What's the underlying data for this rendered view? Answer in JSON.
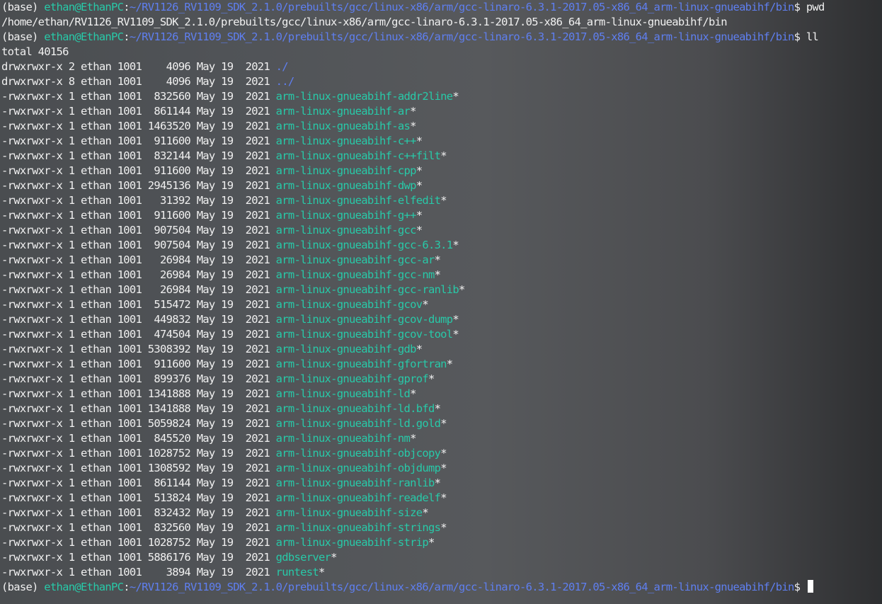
{
  "colors": {
    "user": "#28c9a8",
    "path": "#5f7ff0",
    "text": "#f0f0f0",
    "executable": "#28c9a8",
    "directory": "#5f7ff0"
  },
  "prompt": {
    "env": "(base) ",
    "user": "ethan@EthanPC",
    "sep": ":",
    "cwd": "~/RV1126_RV1109_SDK_2.1.0/prebuilts/gcc/linux-x86/arm/gcc-linaro-6.3.1-2017.05-x86_64_arm-linux-gnueabihf/bin",
    "symbol": "$"
  },
  "commands": [
    " pwd",
    " ll",
    " "
  ],
  "pwd_output": "/home/ethan/RV1126_RV1109_SDK_2.1.0/prebuilts/gcc/linux-x86/arm/gcc-linaro-6.3.1-2017.05-x86_64_arm-linux-gnueabihf/bin",
  "total": "total 40156",
  "listing": [
    {
      "perm": "drwxrwxr-x",
      "links": "2",
      "owner": "ethan",
      "group": "1001",
      "size": "4096",
      "date": "May 19  2021",
      "name": "./",
      "kind": "dir",
      "suffix": ""
    },
    {
      "perm": "drwxrwxr-x",
      "links": "8",
      "owner": "ethan",
      "group": "1001",
      "size": "4096",
      "date": "May 19  2021",
      "name": "../",
      "kind": "dir",
      "suffix": ""
    },
    {
      "perm": "-rwxrwxr-x",
      "links": "1",
      "owner": "ethan",
      "group": "1001",
      "size": "832560",
      "date": "May 19  2021",
      "name": "arm-linux-gnueabihf-addr2line",
      "kind": "exe",
      "suffix": "*"
    },
    {
      "perm": "-rwxrwxr-x",
      "links": "1",
      "owner": "ethan",
      "group": "1001",
      "size": "861144",
      "date": "May 19  2021",
      "name": "arm-linux-gnueabihf-ar",
      "kind": "exe",
      "suffix": "*"
    },
    {
      "perm": "-rwxrwxr-x",
      "links": "1",
      "owner": "ethan",
      "group": "1001",
      "size": "1463520",
      "date": "May 19  2021",
      "name": "arm-linux-gnueabihf-as",
      "kind": "exe",
      "suffix": "*"
    },
    {
      "perm": "-rwxrwxr-x",
      "links": "1",
      "owner": "ethan",
      "group": "1001",
      "size": "911600",
      "date": "May 19  2021",
      "name": "arm-linux-gnueabihf-c++",
      "kind": "exe",
      "suffix": "*"
    },
    {
      "perm": "-rwxrwxr-x",
      "links": "1",
      "owner": "ethan",
      "group": "1001",
      "size": "832144",
      "date": "May 19  2021",
      "name": "arm-linux-gnueabihf-c++filt",
      "kind": "exe",
      "suffix": "*"
    },
    {
      "perm": "-rwxrwxr-x",
      "links": "1",
      "owner": "ethan",
      "group": "1001",
      "size": "911600",
      "date": "May 19  2021",
      "name": "arm-linux-gnueabihf-cpp",
      "kind": "exe",
      "suffix": "*"
    },
    {
      "perm": "-rwxrwxr-x",
      "links": "1",
      "owner": "ethan",
      "group": "1001",
      "size": "2945136",
      "date": "May 19  2021",
      "name": "arm-linux-gnueabihf-dwp",
      "kind": "exe",
      "suffix": "*"
    },
    {
      "perm": "-rwxrwxr-x",
      "links": "1",
      "owner": "ethan",
      "group": "1001",
      "size": "31392",
      "date": "May 19  2021",
      "name": "arm-linux-gnueabihf-elfedit",
      "kind": "exe",
      "suffix": "*"
    },
    {
      "perm": "-rwxrwxr-x",
      "links": "1",
      "owner": "ethan",
      "group": "1001",
      "size": "911600",
      "date": "May 19  2021",
      "name": "arm-linux-gnueabihf-g++",
      "kind": "exe",
      "suffix": "*"
    },
    {
      "perm": "-rwxrwxr-x",
      "links": "1",
      "owner": "ethan",
      "group": "1001",
      "size": "907504",
      "date": "May 19  2021",
      "name": "arm-linux-gnueabihf-gcc",
      "kind": "exe",
      "suffix": "*"
    },
    {
      "perm": "-rwxrwxr-x",
      "links": "1",
      "owner": "ethan",
      "group": "1001",
      "size": "907504",
      "date": "May 19  2021",
      "name": "arm-linux-gnueabihf-gcc-6.3.1",
      "kind": "exe",
      "suffix": "*"
    },
    {
      "perm": "-rwxrwxr-x",
      "links": "1",
      "owner": "ethan",
      "group": "1001",
      "size": "26984",
      "date": "May 19  2021",
      "name": "arm-linux-gnueabihf-gcc-ar",
      "kind": "exe",
      "suffix": "*"
    },
    {
      "perm": "-rwxrwxr-x",
      "links": "1",
      "owner": "ethan",
      "group": "1001",
      "size": "26984",
      "date": "May 19  2021",
      "name": "arm-linux-gnueabihf-gcc-nm",
      "kind": "exe",
      "suffix": "*"
    },
    {
      "perm": "-rwxrwxr-x",
      "links": "1",
      "owner": "ethan",
      "group": "1001",
      "size": "26984",
      "date": "May 19  2021",
      "name": "arm-linux-gnueabihf-gcc-ranlib",
      "kind": "exe",
      "suffix": "*"
    },
    {
      "perm": "-rwxrwxr-x",
      "links": "1",
      "owner": "ethan",
      "group": "1001",
      "size": "515472",
      "date": "May 19  2021",
      "name": "arm-linux-gnueabihf-gcov",
      "kind": "exe",
      "suffix": "*"
    },
    {
      "perm": "-rwxrwxr-x",
      "links": "1",
      "owner": "ethan",
      "group": "1001",
      "size": "449832",
      "date": "May 19  2021",
      "name": "arm-linux-gnueabihf-gcov-dump",
      "kind": "exe",
      "suffix": "*"
    },
    {
      "perm": "-rwxrwxr-x",
      "links": "1",
      "owner": "ethan",
      "group": "1001",
      "size": "474504",
      "date": "May 19  2021",
      "name": "arm-linux-gnueabihf-gcov-tool",
      "kind": "exe",
      "suffix": "*"
    },
    {
      "perm": "-rwxrwxr-x",
      "links": "1",
      "owner": "ethan",
      "group": "1001",
      "size": "5308392",
      "date": "May 19  2021",
      "name": "arm-linux-gnueabihf-gdb",
      "kind": "exe",
      "suffix": "*"
    },
    {
      "perm": "-rwxrwxr-x",
      "links": "1",
      "owner": "ethan",
      "group": "1001",
      "size": "911600",
      "date": "May 19  2021",
      "name": "arm-linux-gnueabihf-gfortran",
      "kind": "exe",
      "suffix": "*"
    },
    {
      "perm": "-rwxrwxr-x",
      "links": "1",
      "owner": "ethan",
      "group": "1001",
      "size": "899376",
      "date": "May 19  2021",
      "name": "arm-linux-gnueabihf-gprof",
      "kind": "exe",
      "suffix": "*"
    },
    {
      "perm": "-rwxrwxr-x",
      "links": "1",
      "owner": "ethan",
      "group": "1001",
      "size": "1341888",
      "date": "May 19  2021",
      "name": "arm-linux-gnueabihf-ld",
      "kind": "exe",
      "suffix": "*"
    },
    {
      "perm": "-rwxrwxr-x",
      "links": "1",
      "owner": "ethan",
      "group": "1001",
      "size": "1341888",
      "date": "May 19  2021",
      "name": "arm-linux-gnueabihf-ld.bfd",
      "kind": "exe",
      "suffix": "*"
    },
    {
      "perm": "-rwxrwxr-x",
      "links": "1",
      "owner": "ethan",
      "group": "1001",
      "size": "5059824",
      "date": "May 19  2021",
      "name": "arm-linux-gnueabihf-ld.gold",
      "kind": "exe",
      "suffix": "*"
    },
    {
      "perm": "-rwxrwxr-x",
      "links": "1",
      "owner": "ethan",
      "group": "1001",
      "size": "845520",
      "date": "May 19  2021",
      "name": "arm-linux-gnueabihf-nm",
      "kind": "exe",
      "suffix": "*"
    },
    {
      "perm": "-rwxrwxr-x",
      "links": "1",
      "owner": "ethan",
      "group": "1001",
      "size": "1028752",
      "date": "May 19  2021",
      "name": "arm-linux-gnueabihf-objcopy",
      "kind": "exe",
      "suffix": "*"
    },
    {
      "perm": "-rwxrwxr-x",
      "links": "1",
      "owner": "ethan",
      "group": "1001",
      "size": "1308592",
      "date": "May 19  2021",
      "name": "arm-linux-gnueabihf-objdump",
      "kind": "exe",
      "suffix": "*"
    },
    {
      "perm": "-rwxrwxr-x",
      "links": "1",
      "owner": "ethan",
      "group": "1001",
      "size": "861144",
      "date": "May 19  2021",
      "name": "arm-linux-gnueabihf-ranlib",
      "kind": "exe",
      "suffix": "*"
    },
    {
      "perm": "-rwxrwxr-x",
      "links": "1",
      "owner": "ethan",
      "group": "1001",
      "size": "513824",
      "date": "May 19  2021",
      "name": "arm-linux-gnueabihf-readelf",
      "kind": "exe",
      "suffix": "*"
    },
    {
      "perm": "-rwxrwxr-x",
      "links": "1",
      "owner": "ethan",
      "group": "1001",
      "size": "832432",
      "date": "May 19  2021",
      "name": "arm-linux-gnueabihf-size",
      "kind": "exe",
      "suffix": "*"
    },
    {
      "perm": "-rwxrwxr-x",
      "links": "1",
      "owner": "ethan",
      "group": "1001",
      "size": "832560",
      "date": "May 19  2021",
      "name": "arm-linux-gnueabihf-strings",
      "kind": "exe",
      "suffix": "*"
    },
    {
      "perm": "-rwxrwxr-x",
      "links": "1",
      "owner": "ethan",
      "group": "1001",
      "size": "1028752",
      "date": "May 19  2021",
      "name": "arm-linux-gnueabihf-strip",
      "kind": "exe",
      "suffix": "*"
    },
    {
      "perm": "-rwxrwxr-x",
      "links": "1",
      "owner": "ethan",
      "group": "1001",
      "size": "5886176",
      "date": "May 19  2021",
      "name": "gdbserver",
      "kind": "exe",
      "suffix": "*"
    },
    {
      "perm": "-rwxrwxr-x",
      "links": "1",
      "owner": "ethan",
      "group": "1001",
      "size": "3894",
      "date": "May 19  2021",
      "name": "runtest",
      "kind": "exe",
      "suffix": "*"
    }
  ]
}
